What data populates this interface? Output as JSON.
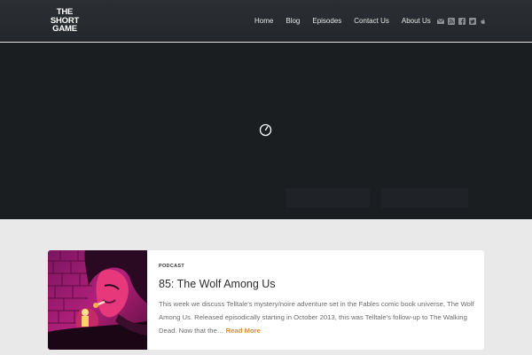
{
  "header": {
    "logo_lines": [
      "THE",
      "SHORT",
      "GAME"
    ],
    "nav": [
      "Home",
      "Blog",
      "Episodes",
      "Contact Us",
      "About Us"
    ],
    "social_icons": [
      "envelope-icon",
      "rss-icon",
      "facebook-icon",
      "twitter-icon",
      "apple-icon"
    ]
  },
  "hero": {
    "state": "loading"
  },
  "post": {
    "category": "PODCAST",
    "title": "85: The Wolf Among Us",
    "excerpt": "This week we discuss Telltale's mystery/noire adventure set in the Fables comic book universe, The Wolf Among Us. Released episodically starting in October 2013, this was Telltale's follow-up to The Walking Dead. Now that the…",
    "read_more": "Read More"
  },
  "colors": {
    "header_bg": "#2b2e32",
    "hero_bg": "#1b1e21",
    "page_bg": "#e9e9e9",
    "accent": "#e08a2a"
  }
}
